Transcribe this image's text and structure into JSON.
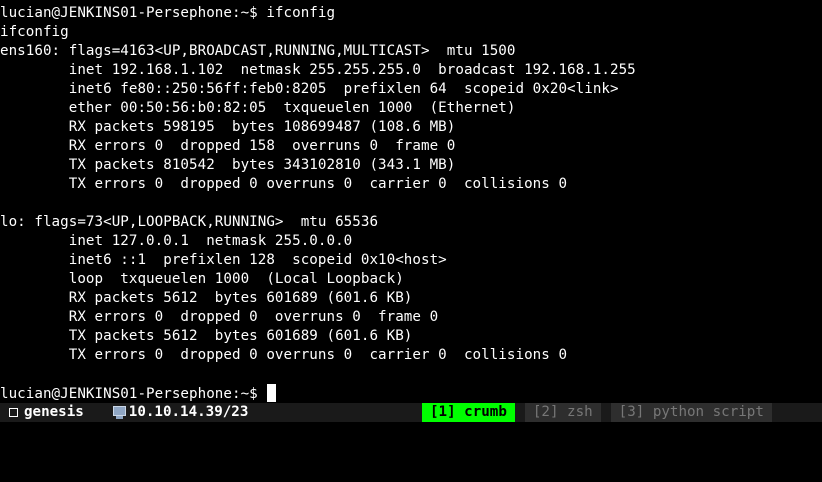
{
  "terminal": {
    "lines": [
      "lucian@JENKINS01-Persephone:~$ ifconfig",
      "ifconfig",
      "ens160: flags=4163<UP,BROADCAST,RUNNING,MULTICAST>  mtu 1500",
      "        inet 192.168.1.102  netmask 255.255.255.0  broadcast 192.168.1.255",
      "        inet6 fe80::250:56ff:feb0:8205  prefixlen 64  scopeid 0x20<link>",
      "        ether 00:50:56:b0:82:05  txqueuelen 1000  (Ethernet)",
      "        RX packets 598195  bytes 108699487 (108.6 MB)",
      "        RX errors 0  dropped 158  overruns 0  frame 0",
      "        TX packets 810542  bytes 343102810 (343.1 MB)",
      "        TX errors 0  dropped 0 overruns 0  carrier 0  collisions 0",
      "",
      "lo: flags=73<UP,LOOPBACK,RUNNING>  mtu 65536",
      "        inet 127.0.0.1  netmask 255.0.0.0",
      "        inet6 ::1  prefixlen 128  scopeid 0x10<host>",
      "        loop  txqueuelen 1000  (Local Loopback)",
      "        RX packets 5612  bytes 601689 (601.6 KB)",
      "        RX errors 0  dropped 0  overruns 0  frame 0",
      "        TX packets 5612  bytes 601689 (601.6 KB)",
      "        TX errors 0  dropped 0 overruns 0  carrier 0  collisions 0",
      ""
    ],
    "prompt": "lucian@JENKINS01-Persephone:~$ "
  },
  "statusbar": {
    "session_icon": "window-square-icon",
    "session_name": "genesis",
    "ip_icon": "monitor-icon",
    "ip": "10.10.14.39/23",
    "tabs": [
      {
        "label": "[1] crumb",
        "active": true
      },
      {
        "label": "[2] zsh",
        "active": false
      },
      {
        "label": "[3] python script",
        "active": false
      }
    ]
  },
  "colors": {
    "background": "#000000",
    "text": "#ffffff",
    "statusbar": "#1a1a1a",
    "active_tab": "#00ff00",
    "inactive_tab_bg": "#2e2e2e",
    "inactive_tab_text": "#777777"
  }
}
